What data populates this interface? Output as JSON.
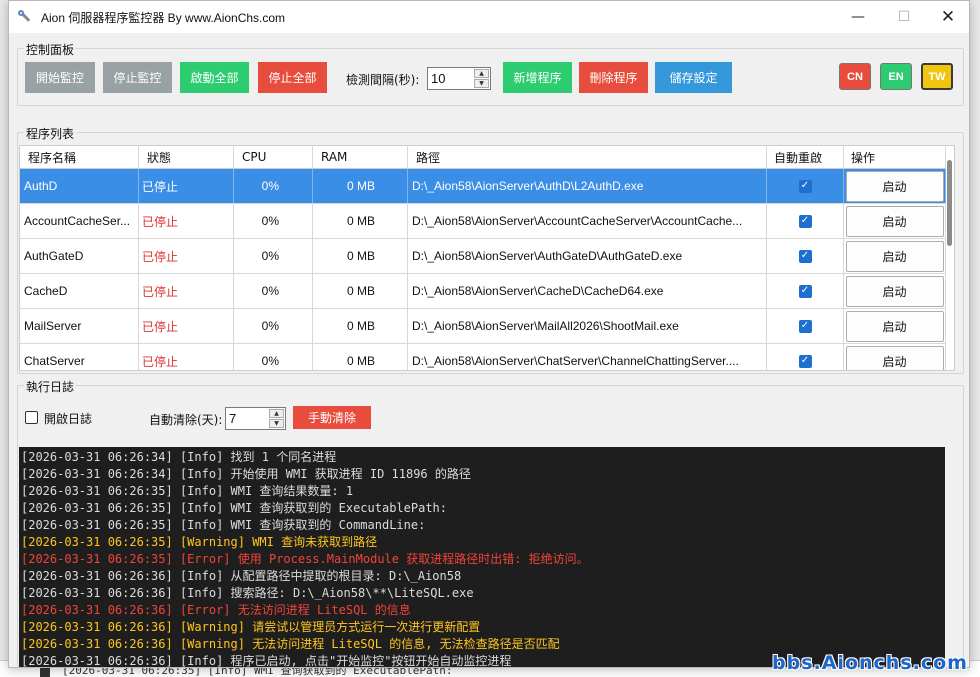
{
  "window": {
    "title": "Aion 伺服器程序監控器 By www.AionChs.com"
  },
  "control_panel": {
    "label": "控制面板",
    "start_monitor": "開始監控",
    "stop_monitor": "停止監控",
    "start_all": "啟動全部",
    "stop_all": "停止全部",
    "interval_label": "檢測間隔(秒):",
    "interval_value": "10",
    "add_program": "新增程序",
    "delete_program": "刪除程序",
    "save_settings": "儲存設定",
    "lang_cn": "CN",
    "lang_en": "EN",
    "lang_tw": "TW"
  },
  "program_list": {
    "label": "程序列表",
    "columns": [
      "程序名稱",
      "狀態",
      "CPU",
      "RAM",
      "路徑",
      "自動重啟",
      "操作"
    ],
    "rows": [
      {
        "name": "AuthD",
        "status": "已停止",
        "cpu": "0%",
        "ram": "0 MB",
        "path": "D:\\_Aion58\\AionServer\\AuthD\\L2AuthD.exe",
        "action": "启动",
        "auto_restart": true
      },
      {
        "name": "AccountCacheSer...",
        "status": "已停止",
        "cpu": "0%",
        "ram": "0 MB",
        "path": "D:\\_Aion58\\AionServer\\AccountCacheServer\\AccountCache...",
        "action": "启动",
        "auto_restart": true
      },
      {
        "name": "AuthGateD",
        "status": "已停止",
        "cpu": "0%",
        "ram": "0 MB",
        "path": "D:\\_Aion58\\AionServer\\AuthGateD\\AuthGateD.exe",
        "action": "启动",
        "auto_restart": true
      },
      {
        "name": "CacheD",
        "status": "已停止",
        "cpu": "0%",
        "ram": "0 MB",
        "path": "D:\\_Aion58\\AionServer\\CacheD\\CacheD64.exe",
        "action": "启动",
        "auto_restart": true
      },
      {
        "name": "MailServer",
        "status": "已停止",
        "cpu": "0%",
        "ram": "0 MB",
        "path": "D:\\_Aion58\\AionServer\\MailAll2026\\ShootMail.exe",
        "action": "启动",
        "auto_restart": true
      },
      {
        "name": "ChatServer",
        "status": "已停止",
        "cpu": "0%",
        "ram": "0 MB",
        "path": "D:\\_Aion58\\AionServer\\ChatServer\\ChannelChattingServer....",
        "action": "启动",
        "auto_restart": true
      }
    ]
  },
  "log_section": {
    "label": "執行日誌",
    "enable_log_label": "開啟日誌",
    "auto_clear_label": "自動清除(天):",
    "auto_clear_value": "7",
    "manual_clear": "手動清除",
    "lines": [
      {
        "level": "info",
        "text": "[2026-03-31 06:26:34] [Info] 找到 1 个同名进程"
      },
      {
        "level": "info",
        "text": "[2026-03-31 06:26:34] [Info] 开始使用 WMI 获取进程 ID 11896 的路径"
      },
      {
        "level": "info",
        "text": "[2026-03-31 06:26:35] [Info] WMI 查询结果数量: 1"
      },
      {
        "level": "info",
        "text": "[2026-03-31 06:26:35] [Info] WMI 查询获取到的 ExecutablePath:"
      },
      {
        "level": "info",
        "text": "[2026-03-31 06:26:35] [Info] WMI 查询获取到的 CommandLine:"
      },
      {
        "level": "warning",
        "text": "[2026-03-31 06:26:35] [Warning] WMI 查询未获取到路径"
      },
      {
        "level": "error",
        "text": "[2026-03-31 06:26:35] [Error] 使用 Process.MainModule 获取进程路径时出错: 拒绝访问。"
      },
      {
        "level": "info",
        "text": "[2026-03-31 06:26:36] [Info] 从配置路径中提取的根目录: D:\\_Aion58"
      },
      {
        "level": "info",
        "text": "[2026-03-31 06:26:36] [Info] 搜索路径: D:\\_Aion58\\**\\LiteSQL.exe"
      },
      {
        "level": "error",
        "text": "[2026-03-31 06:26:36] [Error] 无法访问进程 LiteSQL 的信息"
      },
      {
        "level": "warning",
        "text": "[2026-03-31 06:26:36] [Warning] 请尝试以管理员方式运行一次进行更新配置"
      },
      {
        "level": "warning",
        "text": "[2026-03-31 06:26:36] [Warning] 无法访问进程 LiteSQL 的信息, 无法检查路径是否匹配"
      },
      {
        "level": "info",
        "text": "[2026-03-31 06:26:36] [Info] 程序已启动, 点击\"开始监控\"按钮开始自动监控进程"
      }
    ]
  },
  "background_window": {
    "line": "[2026-03-31 06:26:35] [Info] WMI 查询获取到的 ExecutablePath:"
  },
  "watermark": "bbs.Aionchs.com",
  "colors": {
    "gray_button": "#98a1a4",
    "green_button": "#2ecc71",
    "red_button": "#e74c3c",
    "blue_button": "#3498db",
    "selected_row": "#3a8ee6",
    "log_background": "#1e1e1e",
    "status_stopped": "#e03030",
    "log_warning": "#ffc61e",
    "log_error": "#f0443a"
  }
}
